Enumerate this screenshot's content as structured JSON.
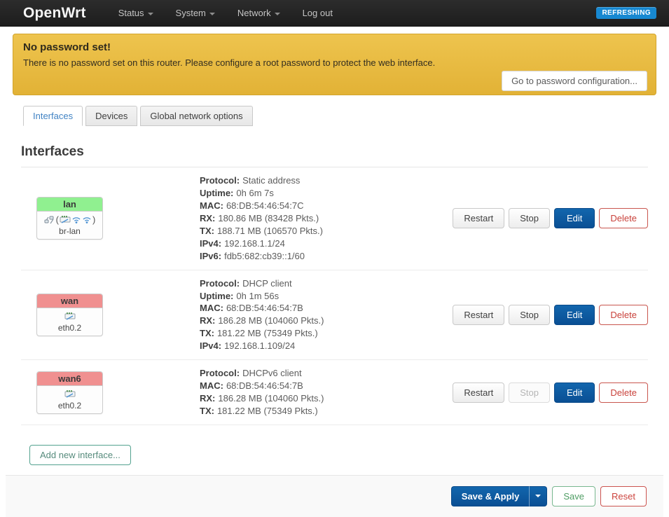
{
  "navbar": {
    "brand": "OpenWrt",
    "items": [
      {
        "label": "Status",
        "has_dropdown": true
      },
      {
        "label": "System",
        "has_dropdown": true
      },
      {
        "label": "Network",
        "has_dropdown": true
      },
      {
        "label": "Log out",
        "has_dropdown": false
      }
    ],
    "poll_badge": "REFRESHING",
    "poll_badge_color": "#1788d1"
  },
  "alert": {
    "title": "No password set!",
    "message": "There is no password set on this router. Please configure a root password to protect the web interface.",
    "action_label": "Go to password configuration..."
  },
  "tabs": [
    {
      "label": "Interfaces",
      "active": true
    },
    {
      "label": "Devices",
      "active": false
    },
    {
      "label": "Global network options",
      "active": false
    }
  ],
  "page_title": "Interfaces",
  "interfaces": [
    {
      "name": "lan",
      "zone_color": "#90f090",
      "device": "br-lan",
      "details": [
        {
          "label": "Protocol:",
          "value": "Static address"
        },
        {
          "label": "Uptime:",
          "value": "0h 6m 7s"
        },
        {
          "label": "MAC:",
          "value": "68:DB:54:46:54:7C"
        },
        {
          "label": "RX:",
          "value": "180.86 MB (83428 Pkts.)"
        },
        {
          "label": "TX:",
          "value": "188.71 MB (106570 Pkts.)"
        },
        {
          "label": "IPv4:",
          "value": "192.168.1.1/24"
        },
        {
          "label": "IPv6:",
          "value": "fdb5:682:cb39::1/60"
        }
      ],
      "actions": {
        "restart": "Restart",
        "stop": "Stop",
        "edit": "Edit",
        "delete": "Delete"
      }
    },
    {
      "name": "wan",
      "zone_color": "#f09090",
      "device": "eth0.2",
      "details": [
        {
          "label": "Protocol:",
          "value": "DHCP client"
        },
        {
          "label": "Uptime:",
          "value": "0h 1m 56s"
        },
        {
          "label": "MAC:",
          "value": "68:DB:54:46:54:7B"
        },
        {
          "label": "RX:",
          "value": "186.28 MB (104060 Pkts.)"
        },
        {
          "label": "TX:",
          "value": "181.22 MB (75349 Pkts.)"
        },
        {
          "label": "IPv4:",
          "value": "192.168.1.109/24"
        }
      ],
      "actions": {
        "restart": "Restart",
        "stop": "Stop",
        "edit": "Edit",
        "delete": "Delete"
      }
    },
    {
      "name": "wan6",
      "zone_color": "#f09090",
      "device": "eth0.2",
      "details": [
        {
          "label": "Protocol:",
          "value": "DHCPv6 client"
        },
        {
          "label": "MAC:",
          "value": "68:DB:54:46:54:7B"
        },
        {
          "label": "RX:",
          "value": "186.28 MB (104060 Pkts.)"
        },
        {
          "label": "TX:",
          "value": "181.22 MB (75349 Pkts.)"
        }
      ],
      "actions": {
        "restart": "Restart",
        "stop": "Stop",
        "edit": "Edit",
        "delete": "Delete"
      }
    }
  ],
  "add_button_label": "Add new interface...",
  "footer": {
    "save_apply": "Save & Apply",
    "save": "Save",
    "reset": "Reset"
  }
}
